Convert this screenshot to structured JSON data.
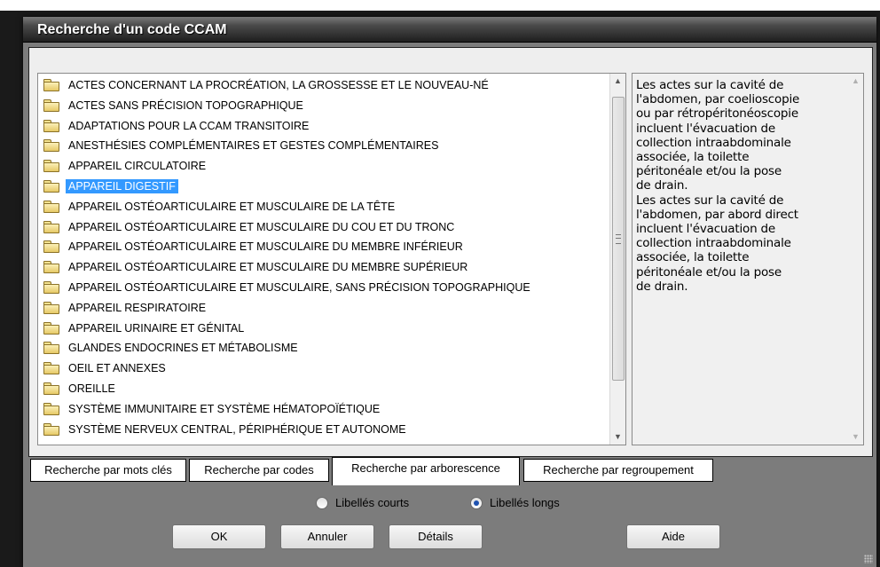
{
  "window": {
    "title": "Recherche d'un code CCAM"
  },
  "tree": {
    "items": [
      {
        "label": "ACTES CONCERNANT LA PROCRÉATION, LA GROSSESSE ET LE NOUVEAU-NÉ"
      },
      {
        "label": "ACTES SANS PRÉCISION TOPOGRAPHIQUE"
      },
      {
        "label": "ADAPTATIONS POUR LA CCAM TRANSITOIRE"
      },
      {
        "label": "ANESTHÉSIES COMPLÉMENTAIRES ET GESTES COMPLÉMENTAIRES"
      },
      {
        "label": "APPAREIL CIRCULATOIRE"
      },
      {
        "label": "APPAREIL DIGESTIF",
        "selected": true
      },
      {
        "label": "APPAREIL OSTÉOARTICULAIRE ET MUSCULAIRE DE LA TÊTE"
      },
      {
        "label": "APPAREIL OSTÉOARTICULAIRE ET MUSCULAIRE DU COU ET DU TRONC"
      },
      {
        "label": "APPAREIL OSTÉOARTICULAIRE ET MUSCULAIRE DU MEMBRE INFÉRIEUR"
      },
      {
        "label": "APPAREIL OSTÉOARTICULAIRE ET MUSCULAIRE DU MEMBRE SUPÉRIEUR"
      },
      {
        "label": "APPAREIL OSTÉOARTICULAIRE ET MUSCULAIRE, SANS PRÉCISION TOPOGRAPHIQUE"
      },
      {
        "label": "APPAREIL RESPIRATOIRE"
      },
      {
        "label": "APPAREIL URINAIRE ET GÉNITAL"
      },
      {
        "label": "GLANDES ENDOCRINES ET MÉTABOLISME"
      },
      {
        "label": "OEIL ET ANNEXES"
      },
      {
        "label": "OREILLE"
      },
      {
        "label": "SYSTÈME IMMUNITAIRE ET SYSTÈME HÉMATOPOÏÉTIQUE"
      },
      {
        "label": "SYSTÈME NERVEUX CENTRAL, PÉRIPHÉRIQUE ET AUTONOME"
      }
    ]
  },
  "description": {
    "lines": [
      "Les actes sur la cavité de",
      "l'abdomen, par coelioscopie",
      "ou par rétropéritonéoscopie",
      "incluent l'évacuation de",
      "collection intraabdominale",
      "associée, la toilette",
      "péritonéale et/ou la pose",
      "de drain.",
      "Les actes sur la cavité de",
      "l'abdomen, par abord direct",
      "incluent l'évacuation de",
      "collection intraabdominale",
      "associée, la toilette",
      "péritonéale et/ou la pose",
      "de drain."
    ]
  },
  "tabs": {
    "keywords": "Recherche par mots clés",
    "codes": "Recherche par codes",
    "tree": "Recherche par arborescence",
    "groups": "Recherche par regroupement"
  },
  "options": {
    "short": "Libellés courts",
    "long": "Libellés longs",
    "selected": "long"
  },
  "buttons": {
    "ok": "OK",
    "cancel": "Annuler",
    "details": "Détails",
    "help": "Aide"
  },
  "icons": {
    "item": "folder-icon",
    "scroll_up": "arrow-up-icon",
    "scroll_down": "arrow-down-icon"
  }
}
